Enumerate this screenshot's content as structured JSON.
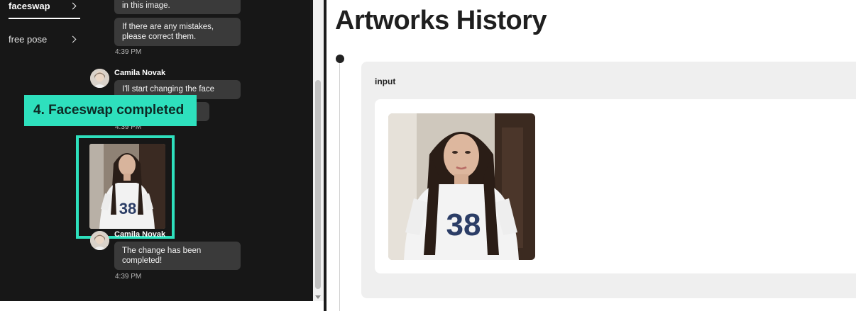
{
  "sidebar": {
    "items": [
      {
        "label": "faceswap",
        "active": true
      },
      {
        "label": "free pose",
        "active": false
      }
    ]
  },
  "chat": {
    "messages": [
      {
        "text": "in this image."
      },
      {
        "text": "If there are any mistakes, please correct them."
      },
      {
        "time": "4:39 PM"
      },
      {
        "sender": "Camila Novak",
        "text": "I'll start changing the face now."
      },
      {
        "text_partial": "t!"
      },
      {
        "time": "4:39 PM"
      },
      {
        "sender": "Camila Novak",
        "text": "The change has been completed!"
      },
      {
        "time": "4:39 PM"
      }
    ],
    "shirt_number": "38"
  },
  "callout": {
    "label": "4. Faceswap completed"
  },
  "right": {
    "title": "Artworks History",
    "card_label": "input",
    "shirt_number": "38"
  },
  "colors": {
    "accent": "#2ee0bd",
    "panel_bg": "#171717",
    "bubble_bg": "#3a3a3a"
  }
}
